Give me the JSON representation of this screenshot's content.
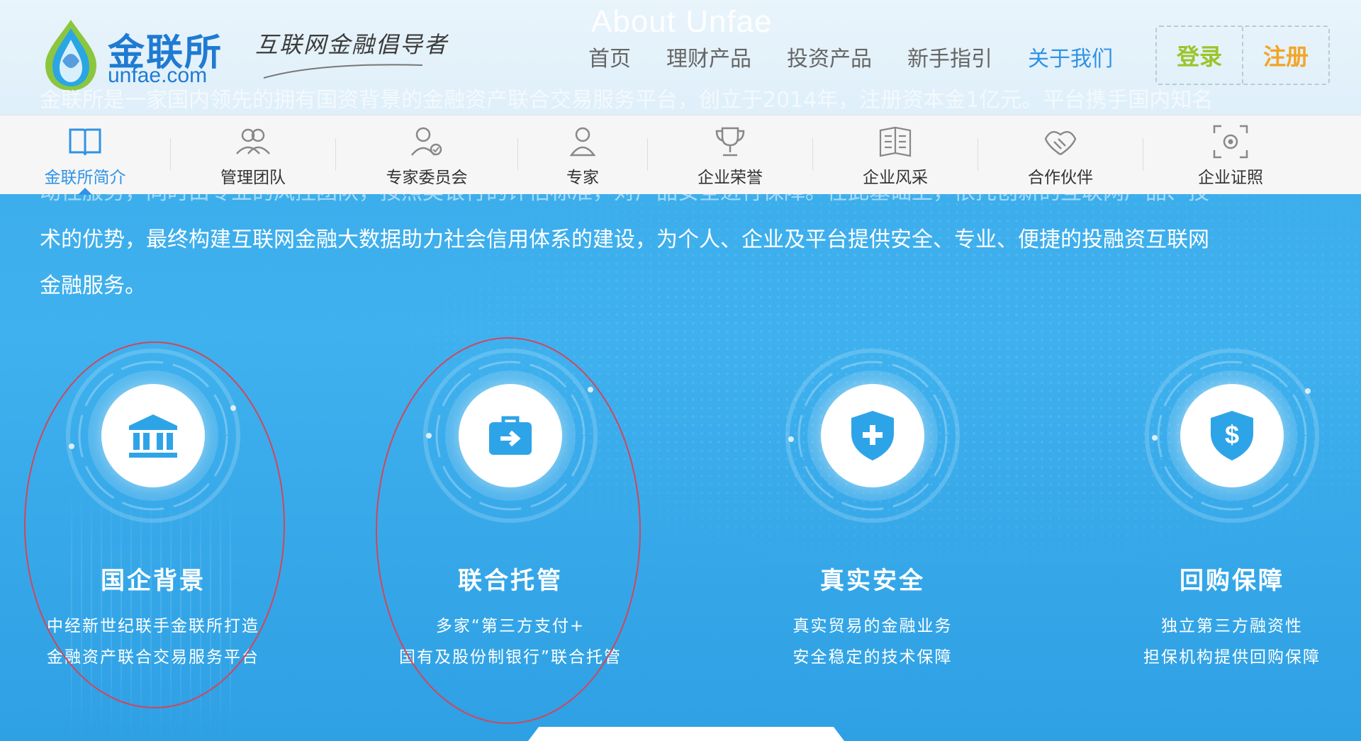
{
  "header": {
    "logo_cn": "金联所",
    "logo_en": "unfae.com",
    "slogan": "互联网金融倡导者",
    "section_title": "About Unfae",
    "nav": [
      "首页",
      "理财产品",
      "投资产品",
      "新手指引",
      "关于我们"
    ],
    "active_nav": "关于我们",
    "login": "登录",
    "register": "注册"
  },
  "intro": {
    "line1": "金联所是一家国内领先的拥有国资背景的金融资产联合交易服务平台，创立于2014年，注册资本金1亿元。平台携手国内知名",
    "line2": "动性服务，同时由专业的风控团队，按照美银行的评估标准，对产品安全进行保障。在此基础上，依托创新的互联网产品、技",
    "line3": "术的优势，最终构建互联网金融大数据助力社会信用体系的建设，为个人、企业及平台提供安全、专业、便捷的投融资互联网",
    "line4": "金融服务。"
  },
  "subnav": [
    {
      "label": "金联所简介",
      "icon": "book-icon",
      "active": true
    },
    {
      "label": "管理团队",
      "icon": "team-icon",
      "active": false
    },
    {
      "label": "专家委员会",
      "icon": "expert-committee-icon",
      "active": false
    },
    {
      "label": "专家",
      "icon": "person-icon",
      "active": false
    },
    {
      "label": "企业荣誉",
      "icon": "trophy-icon",
      "active": false
    },
    {
      "label": "企业风采",
      "icon": "open-book-icon",
      "active": false
    },
    {
      "label": "合作伙伴",
      "icon": "handshake-icon",
      "active": false
    },
    {
      "label": "企业证照",
      "icon": "certificate-camera-icon",
      "active": false
    }
  ],
  "features": [
    {
      "title": "国企背景",
      "desc1": "中经新世纪联手金联所打造",
      "desc2": "金融资产联合交易服务平台",
      "icon": "bank-icon"
    },
    {
      "title": "联合托管",
      "desc1": "多家“第三方支付+",
      "desc2": "国有及股份制银行”联合托管",
      "icon": "briefcase-arrow-icon"
    },
    {
      "title": "真实安全",
      "desc1": "真实贸易的金融业务",
      "desc2": "安全稳定的技术保障",
      "icon": "shield-plus-icon"
    },
    {
      "title": "回购保障",
      "desc1": "独立第三方融资性",
      "desc2": "担保机构提供回购保障",
      "icon": "shield-dollar-icon"
    }
  ],
  "colors": {
    "accent_blue": "#2f93e6",
    "login_green": "#9bc42a",
    "register_orange": "#f2a526",
    "annotation_red": "#d4455a"
  }
}
